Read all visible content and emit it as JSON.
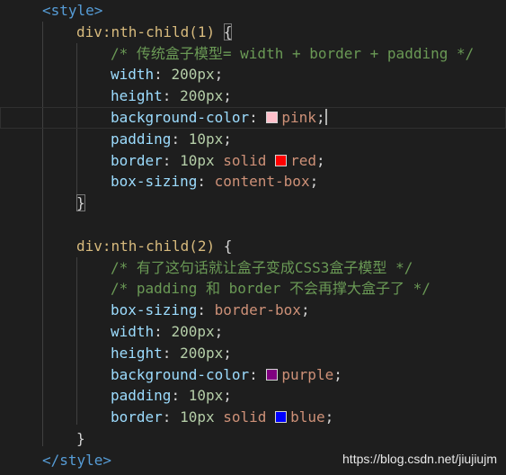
{
  "code": {
    "style_open": "<style>",
    "style_close": "</style>",
    "rule1_selector": "div:nth-child(1)",
    "rule1_brace_open": "{",
    "rule1_comment": "/* 传统盒子模型= width + border + padding */",
    "rule1_width_prop": "width",
    "rule1_width_val": "200px",
    "rule1_height_prop": "height",
    "rule1_height_val": "200px",
    "rule1_bg_prop": "background-color",
    "rule1_bg_val": "pink",
    "rule1_padding_prop": "padding",
    "rule1_padding_val": "10px",
    "rule1_border_prop": "border",
    "rule1_border_width": "10px",
    "rule1_border_style": "solid",
    "rule1_border_color": "red",
    "rule1_boxsizing_prop": "box-sizing",
    "rule1_boxsizing_val": "content-box",
    "rule1_brace_close": "}",
    "rule2_selector": "div:nth-child(2)",
    "rule2_brace_open": "{",
    "rule2_comment1": "/* 有了这句话就让盒子变成CSS3盒子模型 */",
    "rule2_comment2": "/* padding 和 border 不会再撑大盒子了 */",
    "rule2_boxsizing_prop": "box-sizing",
    "rule2_boxsizing_val": "border-box",
    "rule2_width_prop": "width",
    "rule2_width_val": "200px",
    "rule2_height_prop": "height",
    "rule2_height_val": "200px",
    "rule2_bg_prop": "background-color",
    "rule2_bg_val": "purple",
    "rule2_padding_prop": "padding",
    "rule2_padding_val": "10px",
    "rule2_border_prop": "border",
    "rule2_border_width": "10px",
    "rule2_border_style": "solid",
    "rule2_border_color": "blue",
    "rule2_brace_close": "}",
    "colon": ":",
    "semicolon": ";"
  },
  "swatch_colors": {
    "pink": "#ffc0cb",
    "red": "#ff0000",
    "purple": "#800080",
    "blue": "#0000ff"
  },
  "watermark": "https://blog.csdn.net/jiujiujm"
}
